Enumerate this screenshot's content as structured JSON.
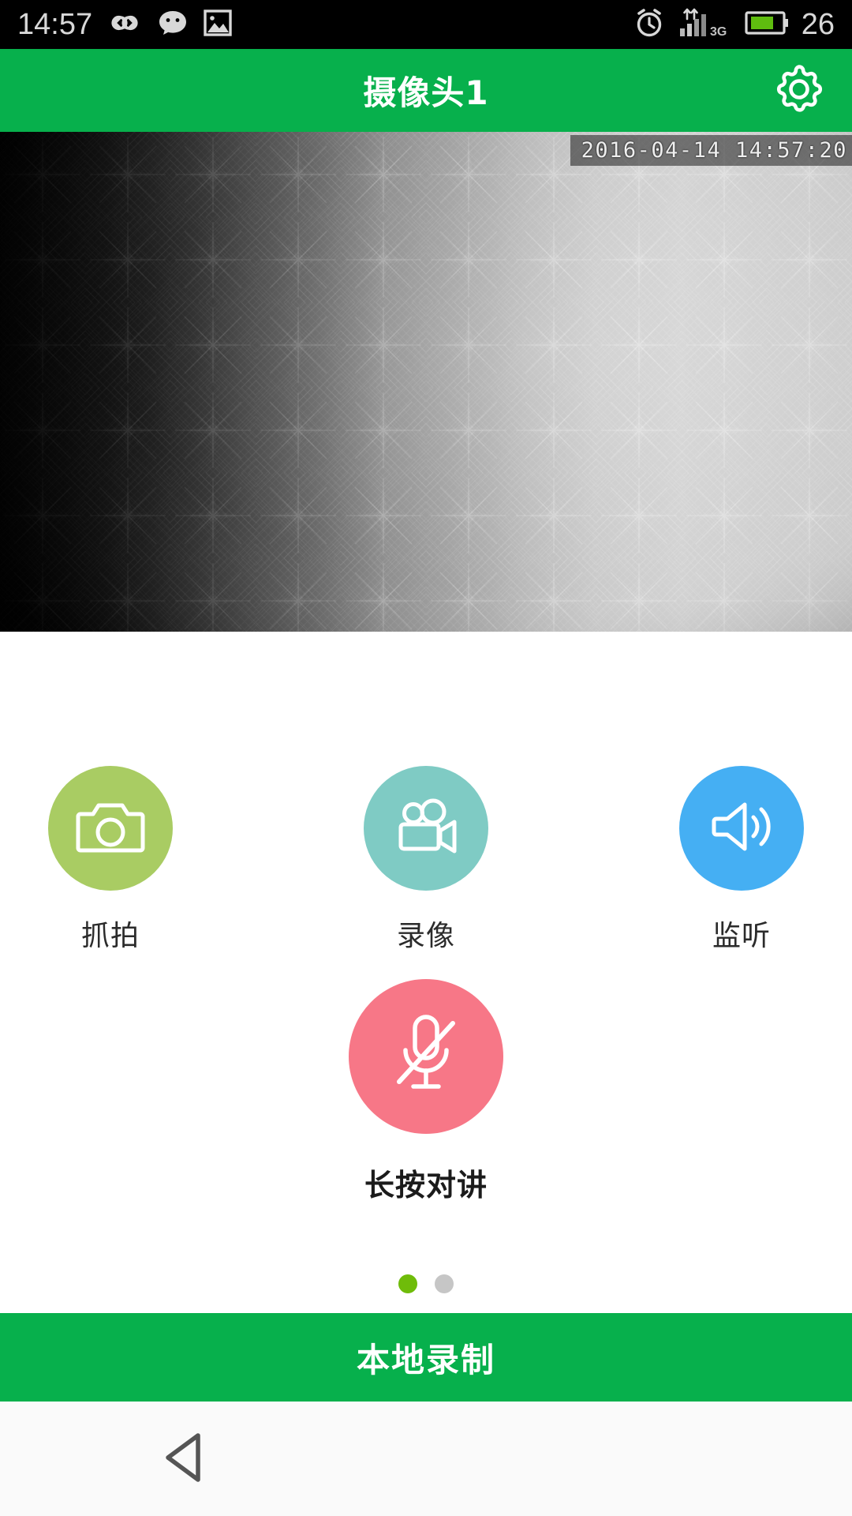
{
  "status_bar": {
    "clock": "14:57",
    "battery_level": "26",
    "network_type": "3G",
    "left_icons": [
      "infinity-icon",
      "wechat-icon",
      "gallery-icon"
    ],
    "right_icons": [
      "alarm-clock-icon",
      "signal-bars-icon",
      "battery-icon"
    ],
    "background_color": "#000000",
    "text_color": "#d8d8d8"
  },
  "header": {
    "title": "摄像头1",
    "settings_icon": "gear-icon",
    "background_color": "#07b04c",
    "text_color": "#ffffff"
  },
  "video": {
    "timestamp": "2016-04-14 14:57:20",
    "feed_description": "grayscale-night-vision-textured-wall"
  },
  "controls": {
    "buttons": [
      {
        "id": "snapshot",
        "label": "抓拍",
        "icon": "camera-icon",
        "color": "#a9cc63"
      },
      {
        "id": "record",
        "label": "录像",
        "icon": "video-camera-icon",
        "color": "#7fcbc4"
      },
      {
        "id": "listen",
        "label": "监听",
        "icon": "speaker-volume-icon",
        "color": "#45aff3"
      }
    ],
    "talk_button": {
      "id": "push-to-talk",
      "label": "长按对讲",
      "icon": "microphone-muted-icon",
      "color": "#f77787"
    }
  },
  "pagination": {
    "total": 2,
    "active_index": 0,
    "active_color": "#6fbc0a",
    "inactive_color": "#c6c6c6"
  },
  "bottom_bar": {
    "label": "本地录制",
    "background_color": "#07b04c"
  },
  "nav_bar": {
    "back_icon": "back-triangle-icon",
    "background_color": "#fafafa"
  }
}
